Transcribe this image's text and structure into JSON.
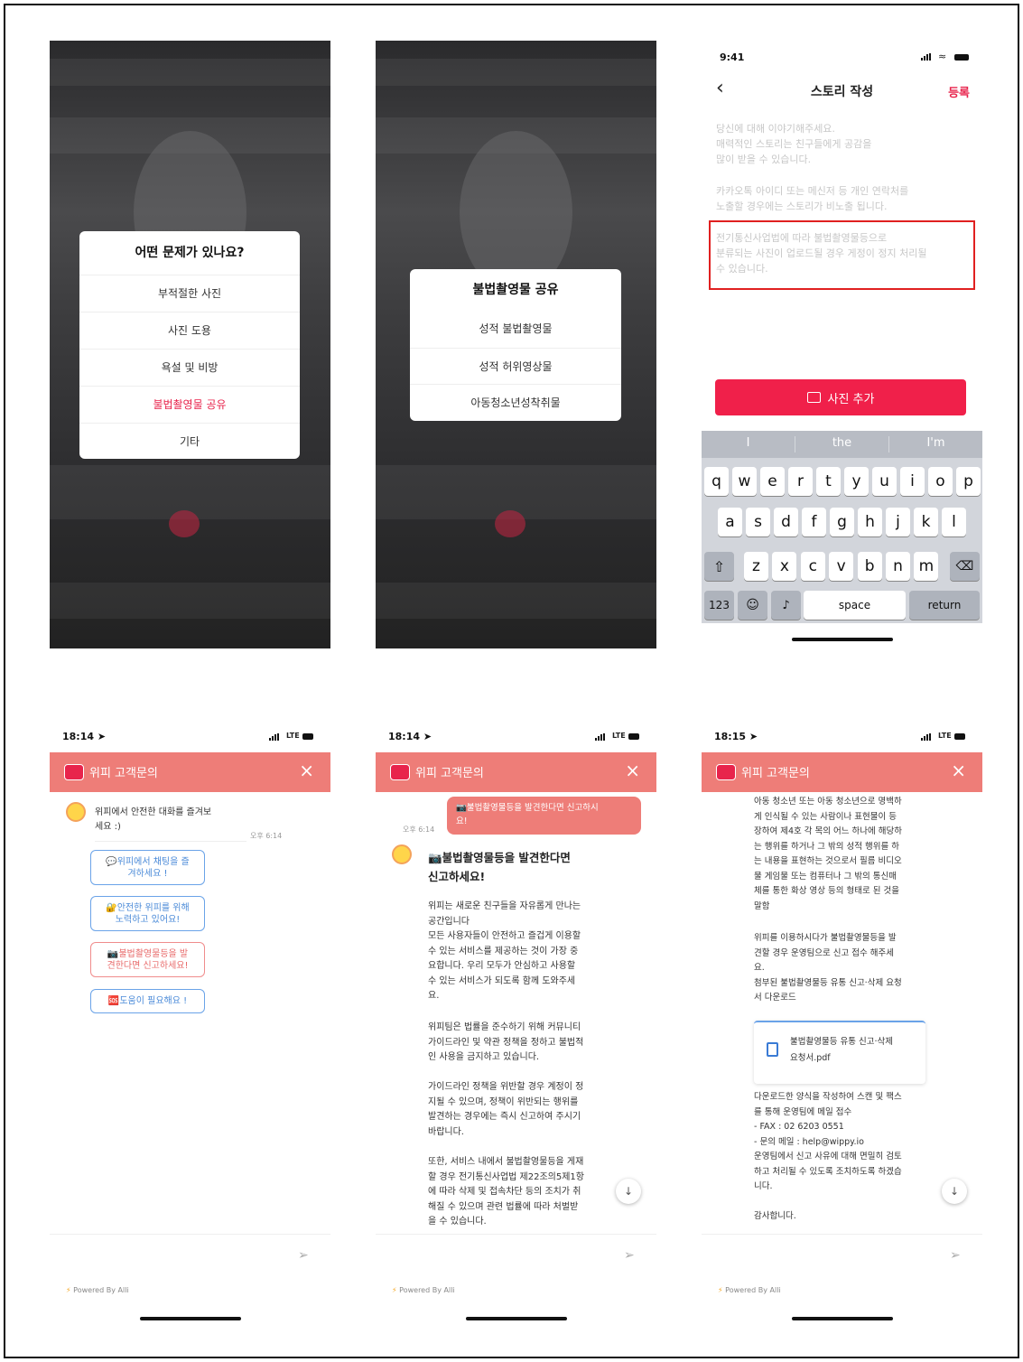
{
  "screen1": {
    "sheet_title": "어떤 문제가 있나요?",
    "items": [
      "부적절한 사진",
      "사진 도용",
      "욕설 및 비방",
      "불법촬영물 공유",
      "기타"
    ]
  },
  "screen2": {
    "sheet_title": "불법촬영물 공유",
    "items": [
      "성적 불법촬영물",
      "성적 허위영상물",
      "아동청소년성착취물"
    ]
  },
  "screen3": {
    "time": "9:41",
    "title": "스토리 작성",
    "back": "‹",
    "action": "등록",
    "intro_1": "당신에 대해 이야기해주세요.",
    "intro_2": "매력적인 스토리는 친구들에게 공감을",
    "intro_3": "많이 받을 수 있습니다.",
    "notice_1": "카카오톡 아이디 또는 메신저 등 개인 연락처를",
    "notice_2": "노출할 경우에는 스토리가 비노출 됩니다.",
    "warning_1": "전기통신사업법에 따라 불법촬영물등으로",
    "warning_2": "분류되는 사진이 업로드될 경우 게정이 정지 처리될",
    "warning_3": "수 있습니다.",
    "add_photo": "사진 추가",
    "suggestions": [
      "I",
      "the",
      "I'm"
    ],
    "row1": [
      "q",
      "w",
      "e",
      "r",
      "t",
      "y",
      "u",
      "i",
      "o",
      "p"
    ],
    "row2": [
      "a",
      "s",
      "d",
      "f",
      "g",
      "h",
      "j",
      "k",
      "l"
    ],
    "row3": [
      "z",
      "x",
      "c",
      "v",
      "b",
      "n",
      "m"
    ],
    "key_123": "123",
    "key_space": "space",
    "key_return": "return"
  },
  "screen4": {
    "time": "18:14",
    "carrier": "LTE",
    "header_title": "위피 고객문의",
    "close": "×",
    "greeting_1": "위피에서 안전한 대화를 즐겨보",
    "greeting_2": "세요 :)",
    "timestamp": "오후 6:14",
    "btn1_1": "💬위피에서 채팅을 즐",
    "btn1_2": "겨하세요 !",
    "btn2_1": "🔐안전한 위피를 위해",
    "btn2_2": "노력하고 있어요!",
    "btn3_1": "📷불법촬영물등을 발",
    "btn3_2": "견한다면 신고하세요!",
    "btn4": "🆘도움이 필요해요 !",
    "send": "➢",
    "powered": "Powered By Alli"
  },
  "screen5": {
    "time": "18:14",
    "carrier": "LTE",
    "header_title": "위피 고객문의",
    "close": "×",
    "user_msg_1": "📷불법촬영물등을 발견한다면 신고하시",
    "user_msg_2": "요!",
    "timestamp": "오후 6:14",
    "title_1": "📷불법촬영물등을 발견한다면",
    "title_2": "신고하세요!",
    "p1": [
      "위피는 새로운 친구들을 자유롭게 만나는",
      "공간입니다",
      "모든 사용자들이 안전하고 즐겁게 이용할",
      "수 있는 서비스를 제공하는 것이 가장 중",
      "요합니다. 우리 모두가 안심하고 사용할",
      "수 있는 서비스가 되도록 함께 도와주세",
      "요."
    ],
    "p2": [
      "위피팀은 법률을 준수하기 위해 커뮤니티",
      "가이드라인 및 약관 정책을 정하고 불법적",
      "인 사용을 금지하고 있습니다."
    ],
    "p3": [
      "가이드라인 정책을 위반할 경우 계정이 정",
      "지될 수 있으며, 정책이 위반되는 행위를",
      "발견하는 경우에는 즉시 신고하여 주시기",
      "바랍니다."
    ],
    "p4": [
      "또한, 서비스 내에서 불법촬영물등을 게재",
      "할 경우 전기통신사업법 제22조의5제1항",
      "에 따라 삭제 및 접속차단 등의 조치가 취",
      "해질 수 있으며 관련 법률에 따라 처벌받",
      "을 수 있습니다."
    ],
    "down": "↓",
    "send": "➢",
    "powered": "Powered By Alli"
  },
  "screen6": {
    "time": "18:15",
    "carrier": "LTE",
    "header_title": "위피 고객문의",
    "close": "×",
    "p1": [
      "아동 청소년 또는 아동 청소년으로 명백하",
      "게 인식될 수 있는 사람이나 표현물이 등",
      "장하여 제4호 각 목의 어느 하나에 해당하",
      "는 행위를 하거나 그 밖의 성적 행위를 하",
      "는 내용을 표현하는 것으로서 필름 비디오",
      "물 게임물 또는 컴퓨터나 그 밖의 통신매",
      "체를 통한 화상 영상 등의 형태로 된 것을",
      "말함"
    ],
    "p2": [
      "위피를 이용하시다가 불법촬영물등을 발",
      "견할 경우 운영팀으로 신고 접수 해주세",
      "요.",
      "첨부된 불법촬영물등 유통 신고·삭제 요청",
      "서 다운로드"
    ],
    "file_1": "불법촬영물등 유통 신고·삭제",
    "file_2": "요청서.pdf",
    "p3": [
      "다운로드한 양식을 작성하여 스캔 및 팩스",
      "를 통해 운영팀에 메일 접수",
      "- FAX : 02 6203 0551",
      "- 문의 메일 : help@wippy.io",
      "운영팀에서 신고 사유에 대해 면밀히 검토",
      "하고 처리될 수 있도록 조치하도록 하겠습",
      "니다."
    ],
    "thanks": "감사합니다.",
    "down": "↓",
    "send": "➢",
    "powered": "Powered By Alli"
  }
}
